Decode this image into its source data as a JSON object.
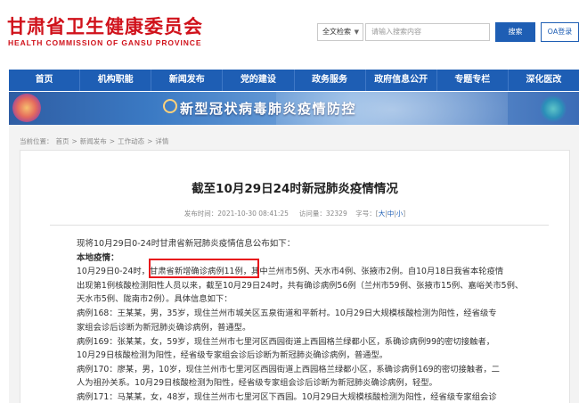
{
  "header": {
    "logo_cn": "甘肃省卫生健康委员会",
    "logo_en": "HEALTH COMMISSION OF GANSU PROVINCE",
    "search_scope": "全文检索",
    "search_placeholder": "请输入搜索内容",
    "search_button": "搜索",
    "oa_button": "OA登录"
  },
  "nav": {
    "items": [
      "首页",
      "机构职能",
      "新闻发布",
      "党的建设",
      "政务服务",
      "政府信息公开",
      "专题专栏",
      "深化医改"
    ]
  },
  "banner": {
    "title": "新型冠状病毒肺炎疫情防控"
  },
  "breadcrumb": {
    "label": "当前位置：",
    "items": [
      "首页",
      "新闻发布",
      "工作动态",
      "详情"
    ],
    "separator": ">"
  },
  "article": {
    "title": "截至10月29日24时新冠肺炎疫情情况",
    "meta": {
      "publish": "发布时间：2021-10-30 08:41:25",
      "views_label": "访问量：",
      "views": "32329",
      "font_label": "字号：",
      "font_sizes": [
        "大",
        "中",
        "小"
      ]
    },
    "lines": [
      "现将10月29日0-24时甘肃省新冠肺炎疫情信息公布如下：",
      "本地疫情：",
      "10月29日0-24时，甘肃省新增确诊病例11例，其中兰州市5例、天水市4例、张掖市2例。自10月18日我省本轮疫情",
      "出现第1例核酸检测阳性人员以来，截至10月29日24时，共有确诊病例56例（兰州市59例、张掖市15例、嘉峪关市5例、",
      "天水市5例、陇南市2例）。具体信息如下：",
      "病例168：王某某，男，35岁，现住兰州市城关区五泉街道和平新村。10月29日大规模核酸检测为阳性，经省级专",
      "家组会诊后诊断为新冠肺炎确诊病例，普通型。",
      "病例169：张某某，女，59岁，现住兰州市七里河区西园街道上西园格兰绿都小区，系确诊病例99的密切接触者，",
      "10月29日核酸检测为阳性，经省级专家组会诊后诊断为新冠肺炎确诊病例，普通型。",
      "病例170：廖某，男，10岁，现住兰州市七里河区西园街道上西园格兰绿都小区，系确诊病例169的密切接触者，二",
      "人为祖孙关系。10月29日核酸检测为阳性，经省级专家组会诊后诊断为新冠肺炎确诊病例，轻型。",
      "病例171：马某某，女，48岁，现住兰州市七里河区下西园。10月29日大规模核酸检测为阳性，经省级专家组会诊"
    ]
  }
}
